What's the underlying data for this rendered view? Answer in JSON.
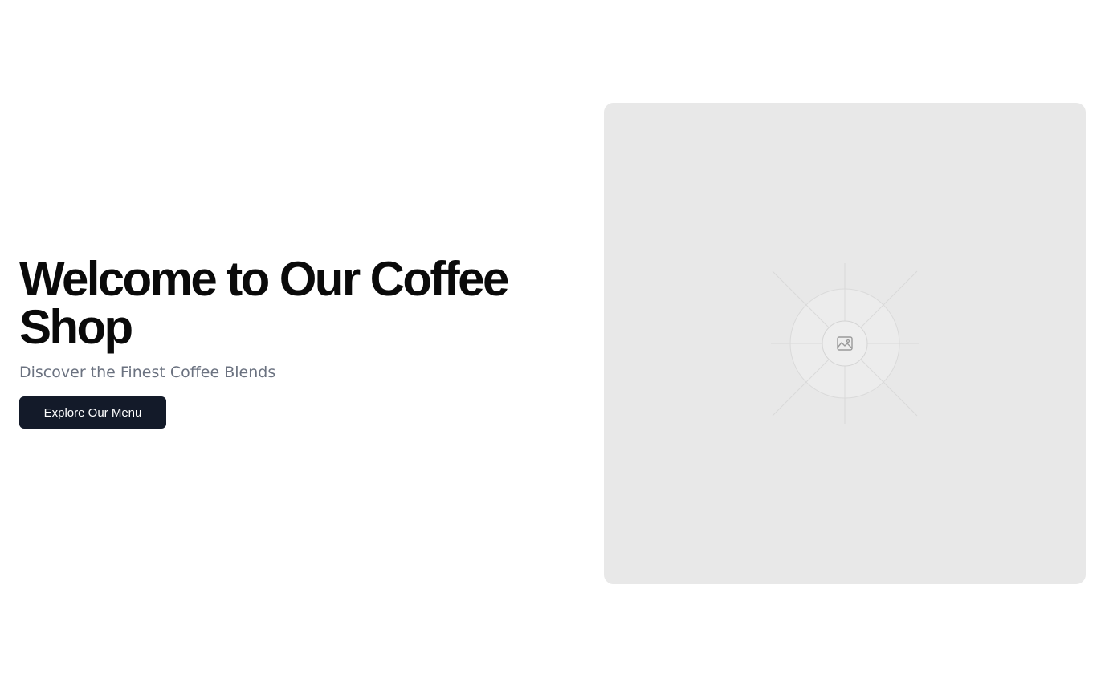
{
  "hero": {
    "title": "Welcome to Our Coffee Shop",
    "subtitle": "Discover the Finest Coffee Blends",
    "cta_label": "Explore Our Menu"
  },
  "image_placeholder": {
    "icon": "image-icon"
  },
  "colors": {
    "title": "#0a0a0a",
    "subtitle": "#6b7280",
    "button_bg": "#131a29",
    "button_text": "#ffffff",
    "placeholder_bg": "#e8e8e8"
  }
}
